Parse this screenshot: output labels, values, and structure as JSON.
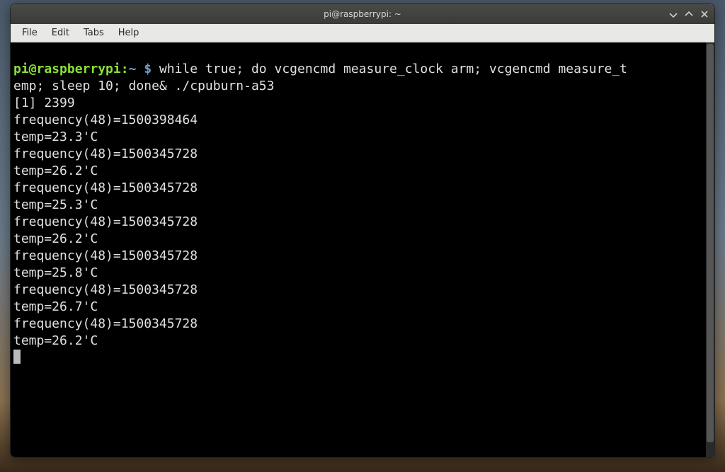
{
  "titlebar": {
    "title": "pi@raspberrypi: ~"
  },
  "menubar": {
    "items": [
      "File",
      "Edit",
      "Tabs",
      "Help"
    ]
  },
  "prompt": {
    "user_host": "pi@raspberrypi",
    "colon": ":",
    "path": "~",
    "sigil": " $ "
  },
  "command": "while true; do vcgencmd measure_clock arm; vcgencmd measure_t\nemp; sleep 10; done& ./cpuburn-a53",
  "output_lines": [
    "[1] 2399",
    "frequency(48)=1500398464",
    "temp=23.3'C",
    "frequency(48)=1500345728",
    "temp=26.2'C",
    "frequency(48)=1500345728",
    "temp=25.3'C",
    "frequency(48)=1500345728",
    "temp=26.2'C",
    "frequency(48)=1500345728",
    "temp=25.8'C",
    "frequency(48)=1500345728",
    "temp=26.7'C",
    "frequency(48)=1500345728",
    "temp=26.2'C"
  ]
}
